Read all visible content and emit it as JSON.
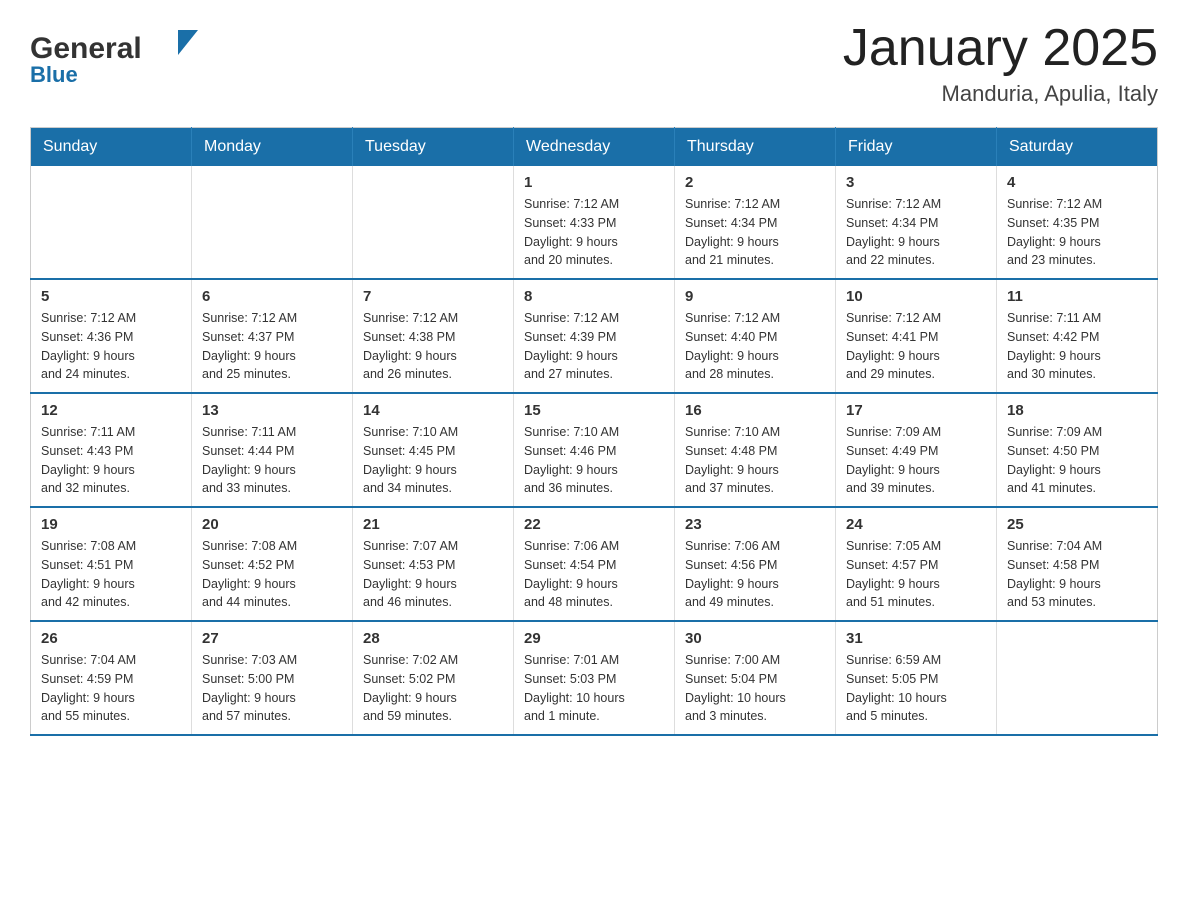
{
  "header": {
    "logo": {
      "general": "General",
      "blue": "Blue",
      "triangle_color": "#1a6fa8"
    },
    "title": "January 2025",
    "subtitle": "Manduria, Apulia, Italy"
  },
  "calendar": {
    "days_of_week": [
      "Sunday",
      "Monday",
      "Tuesday",
      "Wednesday",
      "Thursday",
      "Friday",
      "Saturday"
    ],
    "weeks": [
      {
        "days": [
          {
            "number": "",
            "info": ""
          },
          {
            "number": "",
            "info": ""
          },
          {
            "number": "",
            "info": ""
          },
          {
            "number": "1",
            "info": "Sunrise: 7:12 AM\nSunset: 4:33 PM\nDaylight: 9 hours\nand 20 minutes."
          },
          {
            "number": "2",
            "info": "Sunrise: 7:12 AM\nSunset: 4:34 PM\nDaylight: 9 hours\nand 21 minutes."
          },
          {
            "number": "3",
            "info": "Sunrise: 7:12 AM\nSunset: 4:34 PM\nDaylight: 9 hours\nand 22 minutes."
          },
          {
            "number": "4",
            "info": "Sunrise: 7:12 AM\nSunset: 4:35 PM\nDaylight: 9 hours\nand 23 minutes."
          }
        ]
      },
      {
        "days": [
          {
            "number": "5",
            "info": "Sunrise: 7:12 AM\nSunset: 4:36 PM\nDaylight: 9 hours\nand 24 minutes."
          },
          {
            "number": "6",
            "info": "Sunrise: 7:12 AM\nSunset: 4:37 PM\nDaylight: 9 hours\nand 25 minutes."
          },
          {
            "number": "7",
            "info": "Sunrise: 7:12 AM\nSunset: 4:38 PM\nDaylight: 9 hours\nand 26 minutes."
          },
          {
            "number": "8",
            "info": "Sunrise: 7:12 AM\nSunset: 4:39 PM\nDaylight: 9 hours\nand 27 minutes."
          },
          {
            "number": "9",
            "info": "Sunrise: 7:12 AM\nSunset: 4:40 PM\nDaylight: 9 hours\nand 28 minutes."
          },
          {
            "number": "10",
            "info": "Sunrise: 7:12 AM\nSunset: 4:41 PM\nDaylight: 9 hours\nand 29 minutes."
          },
          {
            "number": "11",
            "info": "Sunrise: 7:11 AM\nSunset: 4:42 PM\nDaylight: 9 hours\nand 30 minutes."
          }
        ]
      },
      {
        "days": [
          {
            "number": "12",
            "info": "Sunrise: 7:11 AM\nSunset: 4:43 PM\nDaylight: 9 hours\nand 32 minutes."
          },
          {
            "number": "13",
            "info": "Sunrise: 7:11 AM\nSunset: 4:44 PM\nDaylight: 9 hours\nand 33 minutes."
          },
          {
            "number": "14",
            "info": "Sunrise: 7:10 AM\nSunset: 4:45 PM\nDaylight: 9 hours\nand 34 minutes."
          },
          {
            "number": "15",
            "info": "Sunrise: 7:10 AM\nSunset: 4:46 PM\nDaylight: 9 hours\nand 36 minutes."
          },
          {
            "number": "16",
            "info": "Sunrise: 7:10 AM\nSunset: 4:48 PM\nDaylight: 9 hours\nand 37 minutes."
          },
          {
            "number": "17",
            "info": "Sunrise: 7:09 AM\nSunset: 4:49 PM\nDaylight: 9 hours\nand 39 minutes."
          },
          {
            "number": "18",
            "info": "Sunrise: 7:09 AM\nSunset: 4:50 PM\nDaylight: 9 hours\nand 41 minutes."
          }
        ]
      },
      {
        "days": [
          {
            "number": "19",
            "info": "Sunrise: 7:08 AM\nSunset: 4:51 PM\nDaylight: 9 hours\nand 42 minutes."
          },
          {
            "number": "20",
            "info": "Sunrise: 7:08 AM\nSunset: 4:52 PM\nDaylight: 9 hours\nand 44 minutes."
          },
          {
            "number": "21",
            "info": "Sunrise: 7:07 AM\nSunset: 4:53 PM\nDaylight: 9 hours\nand 46 minutes."
          },
          {
            "number": "22",
            "info": "Sunrise: 7:06 AM\nSunset: 4:54 PM\nDaylight: 9 hours\nand 48 minutes."
          },
          {
            "number": "23",
            "info": "Sunrise: 7:06 AM\nSunset: 4:56 PM\nDaylight: 9 hours\nand 49 minutes."
          },
          {
            "number": "24",
            "info": "Sunrise: 7:05 AM\nSunset: 4:57 PM\nDaylight: 9 hours\nand 51 minutes."
          },
          {
            "number": "25",
            "info": "Sunrise: 7:04 AM\nSunset: 4:58 PM\nDaylight: 9 hours\nand 53 minutes."
          }
        ]
      },
      {
        "days": [
          {
            "number": "26",
            "info": "Sunrise: 7:04 AM\nSunset: 4:59 PM\nDaylight: 9 hours\nand 55 minutes."
          },
          {
            "number": "27",
            "info": "Sunrise: 7:03 AM\nSunset: 5:00 PM\nDaylight: 9 hours\nand 57 minutes."
          },
          {
            "number": "28",
            "info": "Sunrise: 7:02 AM\nSunset: 5:02 PM\nDaylight: 9 hours\nand 59 minutes."
          },
          {
            "number": "29",
            "info": "Sunrise: 7:01 AM\nSunset: 5:03 PM\nDaylight: 10 hours\nand 1 minute."
          },
          {
            "number": "30",
            "info": "Sunrise: 7:00 AM\nSunset: 5:04 PM\nDaylight: 10 hours\nand 3 minutes."
          },
          {
            "number": "31",
            "info": "Sunrise: 6:59 AM\nSunset: 5:05 PM\nDaylight: 10 hours\nand 5 minutes."
          },
          {
            "number": "",
            "info": ""
          }
        ]
      }
    ]
  }
}
